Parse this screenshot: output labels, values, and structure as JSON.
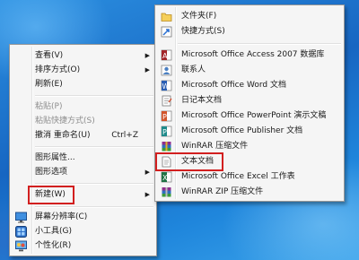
{
  "context_menu": {
    "items": [
      {
        "label": "查看(V)",
        "arrow": "▶"
      },
      {
        "label": "排序方式(O)",
        "arrow": "▶"
      },
      {
        "label": "刷新(E)"
      },
      {
        "label": "粘贴(P)"
      },
      {
        "label": "粘贴快捷方式(S)"
      },
      {
        "label": "撤消 重命名(U)",
        "shortcut": "Ctrl+Z"
      },
      {
        "label": "图形属性..."
      },
      {
        "label": "图形选项",
        "arrow": "▶"
      },
      {
        "label": "新建(W)",
        "arrow": "▶"
      },
      {
        "label": "屏幕分辨率(C)",
        "icon": "screen-resolution-icon"
      },
      {
        "label": "小工具(G)",
        "icon": "gadgets-icon"
      },
      {
        "label": "个性化(R)",
        "icon": "personalize-icon"
      }
    ]
  },
  "new_submenu": {
    "items": [
      {
        "label": "文件夹(F)",
        "icon": "folder-icon"
      },
      {
        "label": "快捷方式(S)",
        "icon": "shortcut-icon"
      },
      {
        "label": "Microsoft Office Access 2007 数据库",
        "icon": "access-icon"
      },
      {
        "label": "联系人",
        "icon": "contact-icon"
      },
      {
        "label": "Microsoft Office Word 文档",
        "icon": "word-icon"
      },
      {
        "label": "日记本文档",
        "icon": "journal-icon"
      },
      {
        "label": "Microsoft Office PowerPoint 演示文稿",
        "icon": "powerpoint-icon"
      },
      {
        "label": "Microsoft Office Publisher 文档",
        "icon": "publisher-icon"
      },
      {
        "label": "WinRAR 压缩文件",
        "icon": "winrar-icon"
      },
      {
        "label": "文本文档",
        "icon": "text-document-icon"
      },
      {
        "label": "Microsoft Office Excel 工作表",
        "icon": "excel-icon"
      },
      {
        "label": "WinRAR ZIP 压缩文件",
        "icon": "winrar-zip-icon"
      }
    ]
  },
  "colors": {
    "highlight_box": "#d21f1f",
    "menu_background": "#f5f5f5",
    "desktop_blue": "#1f7fd0"
  }
}
